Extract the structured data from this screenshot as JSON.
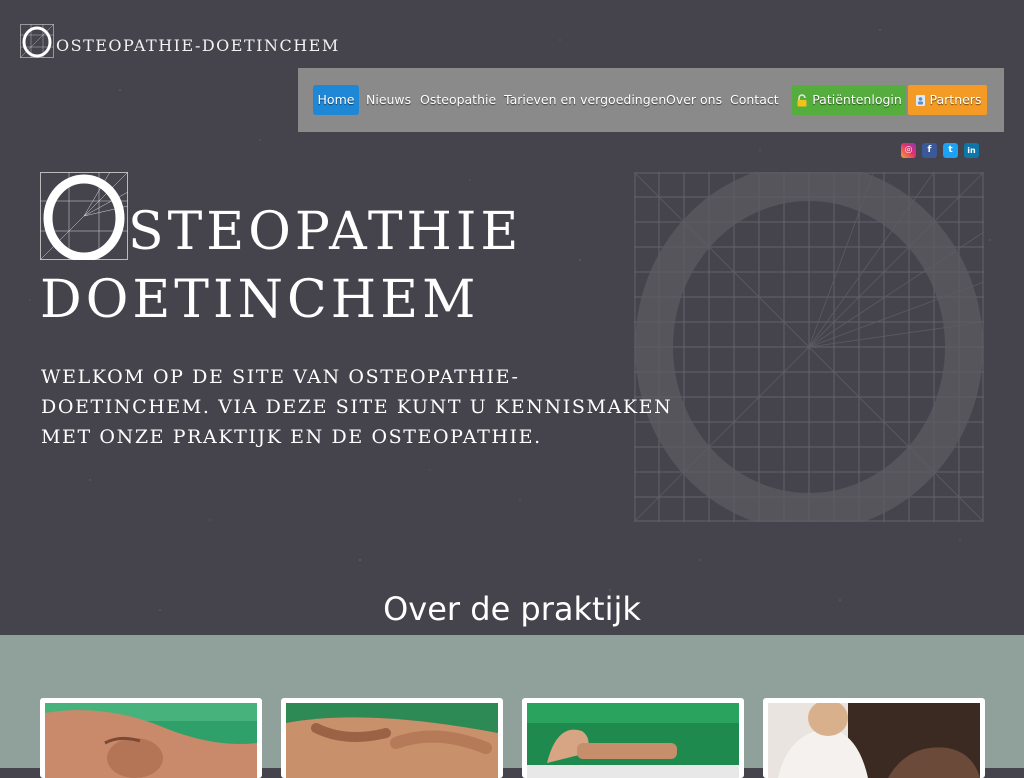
{
  "header": {
    "logo_text": "OSTEOPATHIE-DOETINCHEM"
  },
  "nav": {
    "items": [
      {
        "label": "Home",
        "active": true
      },
      {
        "label": "Nieuws"
      },
      {
        "label": "Osteopathie"
      },
      {
        "label": "Tarieven en vergoedingen"
      },
      {
        "label": "Over ons"
      },
      {
        "label": "Contact"
      }
    ],
    "login": {
      "label": "Patiëntenlogin",
      "icon": "lock-icon",
      "color": "#55ad3e"
    },
    "partners": {
      "label": "Partners",
      "icon": "partners-icon",
      "color": "#f39b25"
    },
    "active_color": "#1e88d6"
  },
  "social": {
    "instagram": {
      "icon": "instagram-icon",
      "glyph": "◎"
    },
    "facebook": {
      "icon": "facebook-icon",
      "glyph": "f"
    },
    "twitter": {
      "icon": "twitter-icon",
      "glyph": "t"
    },
    "linkedin": {
      "icon": "linkedin-icon",
      "glyph": "in"
    }
  },
  "hero": {
    "title_initial": "O",
    "title_line1_rest": "STEOPATHIE",
    "title_line2": "DOETINCHEM",
    "intro": "Welkom op de site van Osteopathie-Doetinchem. Via deze site kunt u kennismaken met onze praktijk en de osteopathie."
  },
  "section": {
    "title": "Over de praktijk"
  },
  "colors": {
    "background": "#45444d",
    "lower_section": "#90a09a",
    "navbar": "#8a8a8a"
  }
}
